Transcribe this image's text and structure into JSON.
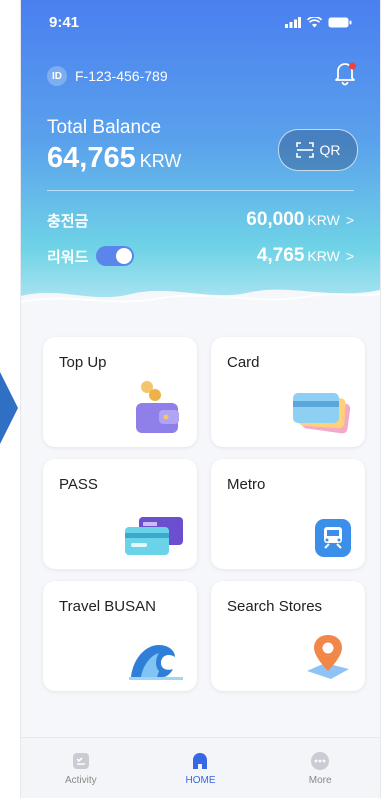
{
  "status": {
    "time": "9:41"
  },
  "header": {
    "id_badge": "ID",
    "id_value": "F-123-456-789",
    "total_label": "Total Balance",
    "total_amount": "64,765",
    "total_unit": "KRW",
    "qr_label": "QR"
  },
  "balances": [
    {
      "label": "충전금",
      "amount": "60,000",
      "unit": "KRW",
      "chevron": ">"
    },
    {
      "label": "리워드",
      "amount": "4,765",
      "unit": "KRW",
      "chevron": ">",
      "toggle_on": true
    }
  ],
  "tiles": [
    {
      "title": "Top Up",
      "icon": "wallet-coin-icon"
    },
    {
      "title": "Card",
      "icon": "cards-stack-icon"
    },
    {
      "title": "PASS",
      "icon": "pass-cards-icon"
    },
    {
      "title": "Metro",
      "icon": "train-icon"
    },
    {
      "title": "Travel BUSAN",
      "icon": "wave-icon"
    },
    {
      "title": "Search Stores",
      "icon": "location-pin-icon"
    }
  ],
  "nav": [
    {
      "label": "Activity",
      "icon": "activity-icon",
      "active": false
    },
    {
      "label": "HOME",
      "icon": "home-icon",
      "active": true
    },
    {
      "label": "More",
      "icon": "more-icon",
      "active": false
    }
  ],
  "colors": {
    "accent": "#3867e5",
    "hero_top": "#4a7ff0",
    "hero_bottom": "#6fd3e6"
  }
}
